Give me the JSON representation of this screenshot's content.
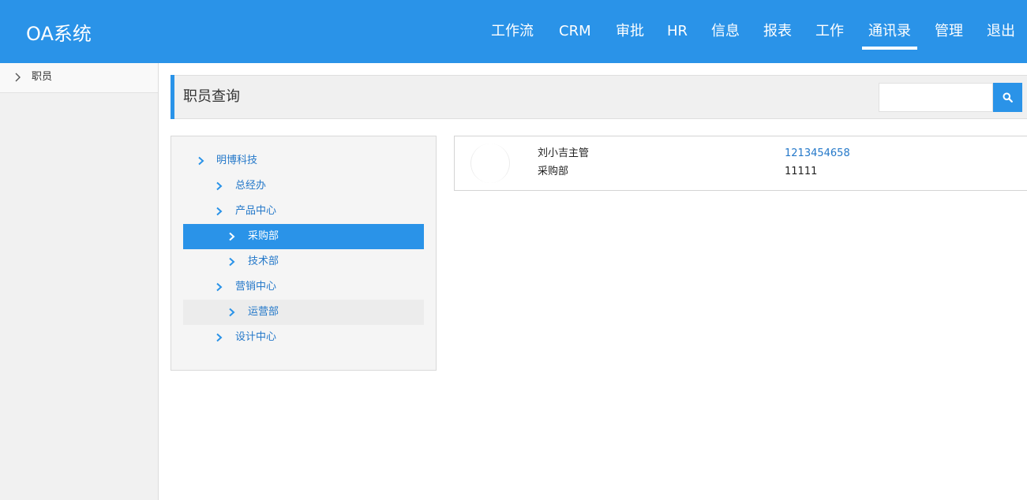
{
  "header": {
    "brand": "OA系统",
    "nav": [
      {
        "label": "工作流"
      },
      {
        "label": "CRM"
      },
      {
        "label": "审批"
      },
      {
        "label": "HR"
      },
      {
        "label": "信息"
      },
      {
        "label": "报表"
      },
      {
        "label": "工作"
      },
      {
        "label": "通讯录",
        "active": true
      },
      {
        "label": "管理"
      },
      {
        "label": "退出"
      }
    ]
  },
  "sidebar": {
    "items": [
      {
        "label": "职员",
        "icon": "chevron-right-icon"
      }
    ]
  },
  "main": {
    "title": "职员查询",
    "search": {
      "value": "",
      "placeholder": ""
    }
  },
  "tree": {
    "nodes": [
      {
        "label": "明博科技",
        "level": 0
      },
      {
        "label": "总经办",
        "level": 1
      },
      {
        "label": "产品中心",
        "level": 1
      },
      {
        "label": "采购部",
        "level": 2,
        "selected": true
      },
      {
        "label": "技术部",
        "level": 2
      },
      {
        "label": "营销中心",
        "level": 1
      },
      {
        "label": "运营部",
        "level": 2,
        "hover": true
      },
      {
        "label": "设计中心",
        "level": 1
      }
    ]
  },
  "employees": [
    {
      "name": "刘小吉主管",
      "department": "采购部",
      "phone": "1213454658",
      "extension": "11111"
    }
  ],
  "colors": {
    "primary": "#2a93e8",
    "link": "#2478c9",
    "panel_bg": "#f5f5f5",
    "sidebar_bg": "#f1f1f1"
  }
}
